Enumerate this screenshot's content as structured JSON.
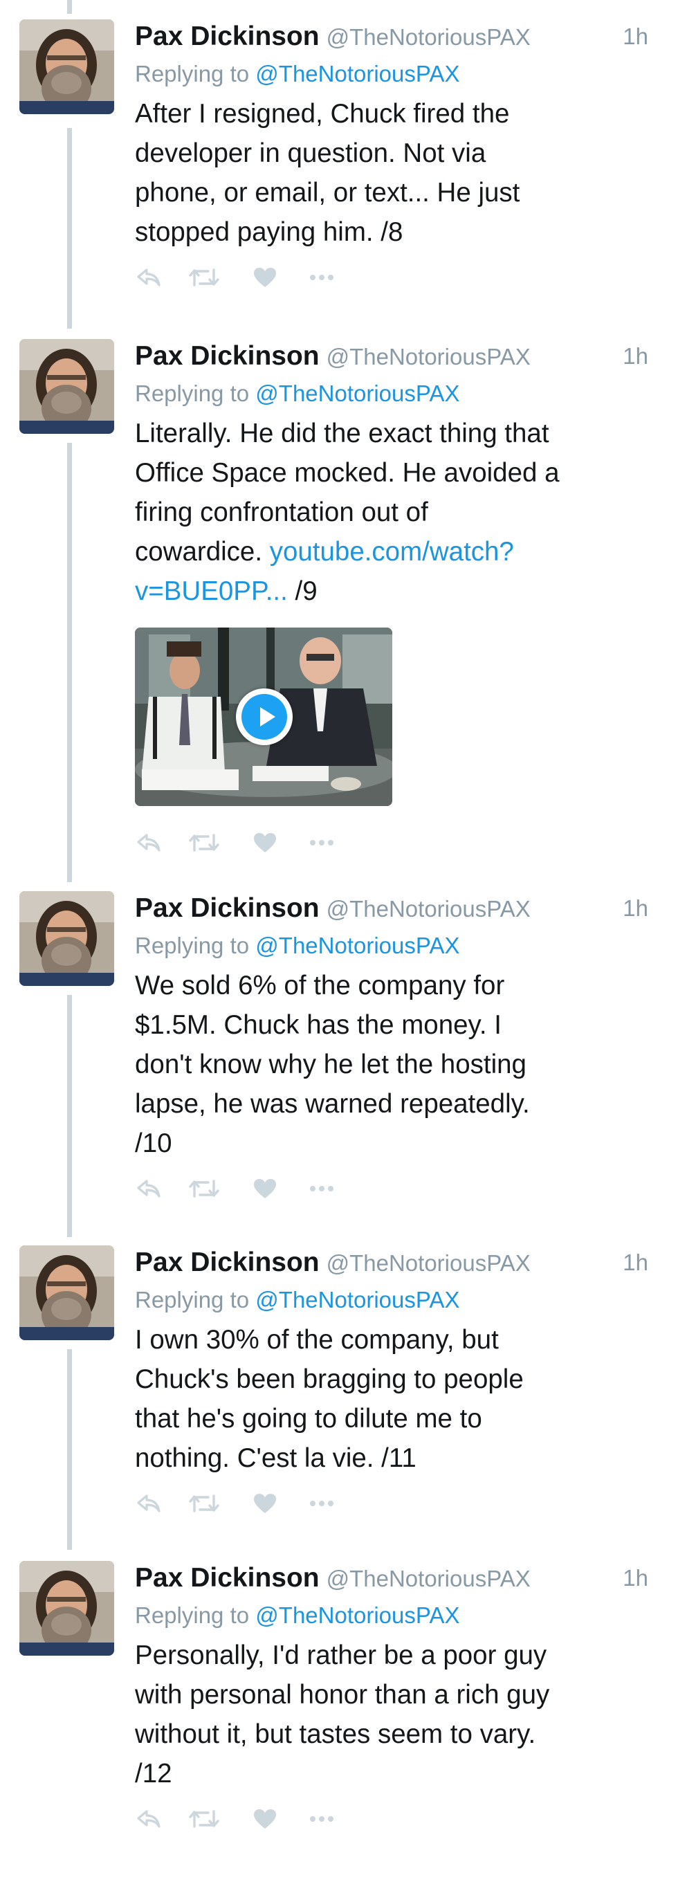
{
  "author": {
    "name": "Pax Dickinson",
    "handle": "@TheNotoriousPAX"
  },
  "reply_prefix": "Replying to",
  "icons": {
    "reply": "reply-icon",
    "retweet": "retweet-icon",
    "like": "heart-icon",
    "more": "more-icon"
  },
  "colors": {
    "link": "#1b95e0",
    "secondary": "#8899a6",
    "action_icon": "#ccd6dd",
    "thread_line": "#ccd6dd",
    "play_button": "#1da1f2"
  },
  "tweets": [
    {
      "time": "1h",
      "reply_to": "@TheNotoriousPAX",
      "text": "After I resigned, Chuck fired the\ndeveloper in question. Not via\nphone, or email, or text...  He just\nstopped paying him. /8",
      "link": "",
      "suffix": ""
    },
    {
      "time": "1h",
      "reply_to": "@TheNotoriousPAX",
      "text": "Literally. He did the exact thing that\nOffice Space mocked. He avoided a\nfiring confrontation out of\ncowardice. ",
      "link": "youtube.com/watch?\nv=BUE0PP...",
      "suffix": " /9"
    },
    {
      "time": "1h",
      "reply_to": "@TheNotoriousPAX",
      "text": "We sold 6% of the company for\n$1.5M. Chuck has the money. I\ndon't know why he let the hosting\nlapse, he was warned repeatedly.\n/10",
      "link": "",
      "suffix": ""
    },
    {
      "time": "1h",
      "reply_to": "@TheNotoriousPAX",
      "text": "I own 30% of the company, but\nChuck's been bragging to people\nthat he's going to dilute me to\nnothing. C'est la vie. /11",
      "link": "",
      "suffix": ""
    },
    {
      "time": "1h",
      "reply_to": "@TheNotoriousPAX",
      "text": "Personally, I'd rather be a poor guy\nwith personal honor than a rich guy\nwithout it, but tastes seem to vary.\n/12",
      "link": "",
      "suffix": ""
    }
  ]
}
